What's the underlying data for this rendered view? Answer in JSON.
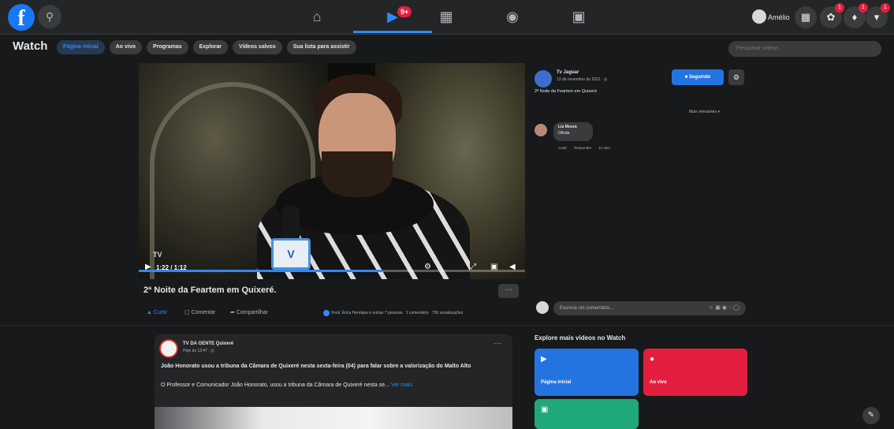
{
  "nav": {
    "logo": "f",
    "tabs": [
      {
        "icon": "home-icon",
        "glyph": "⌂",
        "badge": ""
      },
      {
        "icon": "watch-icon",
        "glyph": "▶",
        "badge": "9+"
      },
      {
        "icon": "marketplace-icon",
        "glyph": "▦",
        "badge": ""
      },
      {
        "icon": "groups-icon",
        "glyph": "◉",
        "badge": ""
      },
      {
        "icon": "gaming-icon",
        "glyph": "▣",
        "badge": ""
      }
    ],
    "profile_name": "Amélio",
    "badges": {
      "messenger": "1",
      "notifications": "1",
      "account": "1"
    }
  },
  "watch": {
    "title": "Watch",
    "pills": [
      "Página inicial",
      "Ao vivo",
      "Programas",
      "Explorar",
      "Vídeos salvos",
      "Sua lista para assistir"
    ],
    "search_placeholder": "Pesquisar vídeos"
  },
  "player": {
    "timecode": "1:22 / 1:12",
    "progress": 0.63
  },
  "video": {
    "title": "2ª Noite da Feartem em Quixeré.",
    "more": "···",
    "actions": {
      "like": "Curtir",
      "comment": "Comentar",
      "share": "Compartilhar"
    },
    "reactions": "Você, Érica Henrique e outras 7 pessoas",
    "comments_count": "1 comentário",
    "views": "726 visualizações"
  },
  "post_info": {
    "page_name": "Tv Jaguar",
    "date": "13 de novembro de 2021 · ◎",
    "caption": "2ª Noite da Feartem em Quixeré",
    "follow_label": "Seguindo",
    "relevance": "Mais relevantes ▾"
  },
  "comment": {
    "author": "Lia Moura",
    "text": "Olinda",
    "like": "Curtir",
    "reply": "Responder",
    "time": "11 sem"
  },
  "write_comment": {
    "placeholder": "Escreva um comentário..."
  },
  "feed": {
    "page_name": "TV DA GENTE Quixeré",
    "time": "Hoje às 13:47 · ◎",
    "headline": "João Honorato usou a tribuna da Câmara de Quixeré nesta sexta-feira (04) para falar sobre a valorização do Malto Alto",
    "body": "O Professor e Comunicador João Honorato, usou a tribuna da Câmara de Quixeré nesta se...",
    "see_more": "Ver mais"
  },
  "explore": {
    "title": "Explore mais vídeos no Watch",
    "tiles": [
      {
        "label": "Página inicial",
        "color": "#2374e1"
      },
      {
        "label": "Ao vivo",
        "color": "#e41e3f"
      },
      {
        "label": "",
        "color": "#1fa87a"
      }
    ]
  }
}
